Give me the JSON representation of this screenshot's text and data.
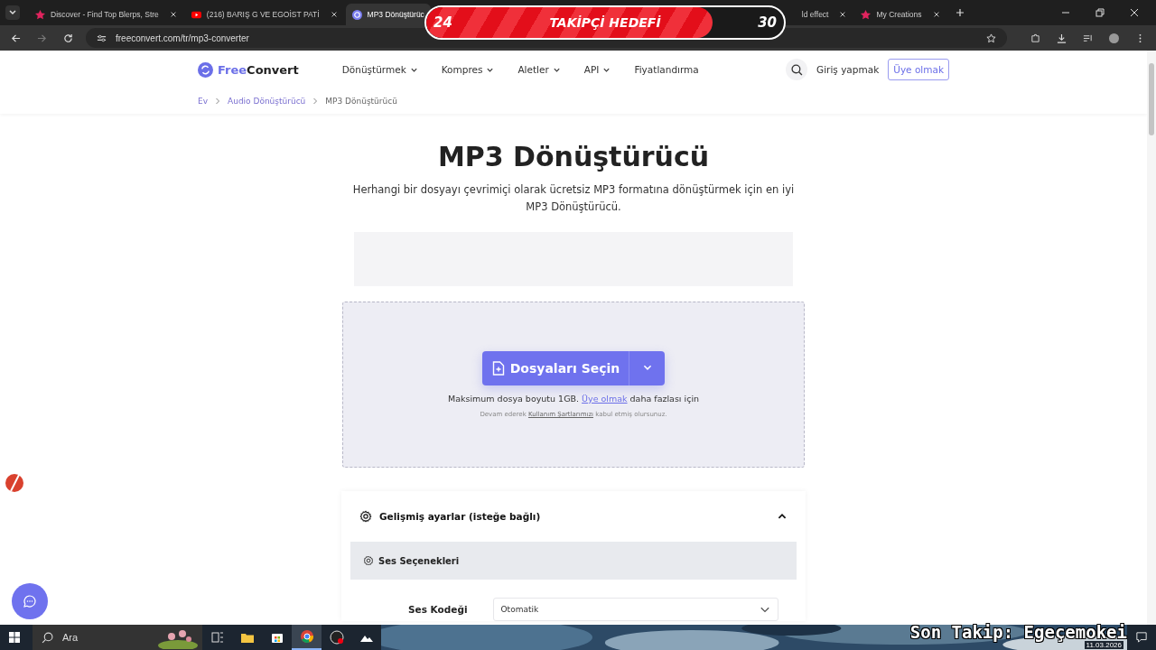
{
  "browser": {
    "tabs": [
      {
        "title": "Discover - Find Top Blerps, Stre",
        "selected": false
      },
      {
        "title": "(216) BARIŞ G VE EGOİST PATİ",
        "selected": false
      },
      {
        "title": "MP3 Dönüştürüc",
        "selected": true
      },
      {
        "title": "ld effect",
        "selected": false
      },
      {
        "title": "My Creations",
        "selected": false
      }
    ],
    "url": "freeconvert.com/tr/mp3-converter"
  },
  "goal_overlay": {
    "current": "24",
    "label": "TAKİPÇİ HEDEFİ",
    "target": "30",
    "level": 0.8
  },
  "site": {
    "logo_a": "Free",
    "logo_b": "Convert",
    "nav": [
      {
        "label": "Dönüştürmek",
        "dropdown": true
      },
      {
        "label": "Kompres",
        "dropdown": true
      },
      {
        "label": "Aletler",
        "dropdown": true
      },
      {
        "label": "API",
        "dropdown": true
      },
      {
        "label": "Fiyatlandırma",
        "dropdown": false
      }
    ],
    "login": "Giriş yapmak",
    "signup": "Üye olmak",
    "breadcrumb": [
      "Ev",
      "Audio Dönüştürücü",
      "MP3 Dönüştürücü"
    ]
  },
  "title": "MP3 Dönüştürücü",
  "description": "Herhangi bir dosyayı çevrimiçi olarak ücretsiz MP3 formatına dönüştürmek için en iyi MP3 Dönüştürücü.",
  "upload": {
    "button": "Dosyaları Seçin",
    "limit_before": "Maksimum dosya boyutu 1GB.",
    "limit_link": "Üye olmak",
    "limit_after": "daha fazlası için",
    "terms_before": "Devam ederek",
    "terms_link": "Kullanım Şartlarımızı",
    "terms_after": "kabul etmiş olursunuz."
  },
  "settings": {
    "title": "Gelişmiş ayarlar (isteğe bağlı)",
    "expanded": true,
    "section": "Ses Seçenekleri",
    "codec_label": "Ses Kodeği",
    "codec_value": "Otomatik"
  },
  "taskbar": {
    "search": "Ara",
    "date": "11.03.2026",
    "apps": [
      {
        "kind": "taskview",
        "active": false
      },
      {
        "kind": "folder",
        "active": false
      },
      {
        "kind": "store",
        "active": false
      },
      {
        "kind": "chrome",
        "active": true
      },
      {
        "kind": "obs",
        "active": false
      },
      {
        "kind": "photos",
        "active": false
      }
    ]
  },
  "last_follower_overlay": "Son Takip: Egeçemokei"
}
